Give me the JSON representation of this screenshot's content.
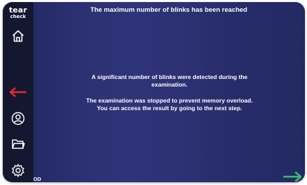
{
  "app": {
    "logo_line1": "tear",
    "logo_line2": "check"
  },
  "header": {
    "title": "The maximum number of blinks has been reached"
  },
  "main": {
    "message_lines_1": [
      "A significant number of blinks were detected during the",
      "examination."
    ],
    "message_lines_2": [
      "The examination was stopped to prevent memory overload.",
      "You can access the result by going to the next step."
    ]
  },
  "footer": {
    "eye_label": "OD"
  },
  "sidebar": {
    "icons": [
      "home-icon",
      "back-arrow-icon",
      "user-icon",
      "folder-icon",
      "settings-icon"
    ]
  },
  "colors": {
    "background": "#1d2148",
    "sidebar": "#141730",
    "back_arrow": "#ee2a2a",
    "next_arrow": "#39c26b",
    "text": "#ffffff"
  }
}
